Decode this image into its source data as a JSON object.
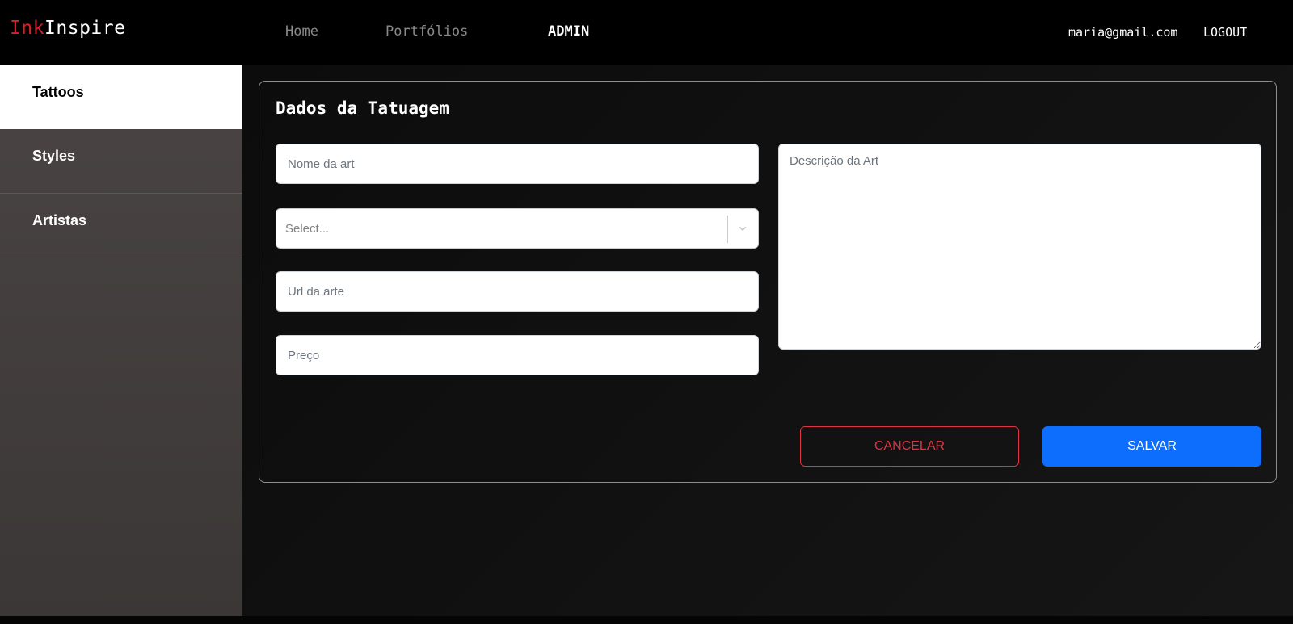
{
  "app": {
    "logo_part1": "Ink",
    "logo_part2": "Inspire",
    "brand_color": "#d8202a"
  },
  "nav": {
    "items": [
      {
        "label": "Home",
        "active": false
      },
      {
        "label": "Portfólios",
        "active": false
      },
      {
        "label": "ADMIN",
        "active": true
      }
    ]
  },
  "user": {
    "email": "maria@gmail.com",
    "logout_label": "LOGOUT"
  },
  "sidebar": {
    "items": [
      {
        "label": "Tattoos",
        "active": true
      },
      {
        "label": "Styles",
        "active": false
      },
      {
        "label": "Artistas",
        "active": false
      }
    ]
  },
  "form": {
    "title": "Dados da Tatuagem",
    "name_placeholder": "Nome da art",
    "select_placeholder": "Select...",
    "url_placeholder": "Url da arte",
    "price_placeholder": "Preço",
    "description_placeholder": "Descrição da Art",
    "cancel_label": "CANCELAR",
    "save_label": "SALVAR",
    "cancel_color": "#dc3545",
    "save_color": "#0d6efd"
  }
}
